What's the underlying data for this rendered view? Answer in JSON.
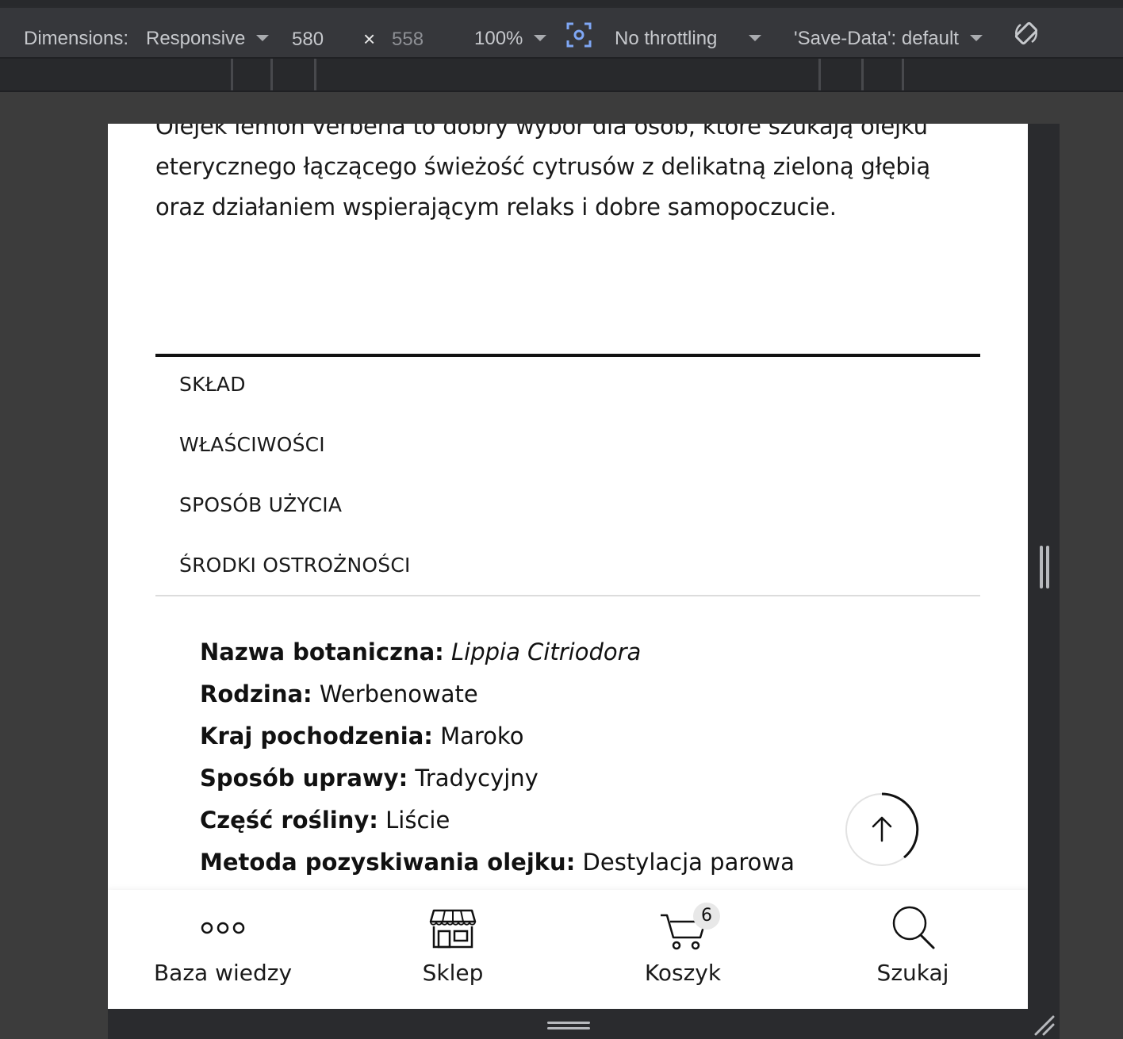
{
  "devtools": {
    "dimensions_label": "Dimensions:",
    "mode": "Responsive",
    "width": "580",
    "times": "×",
    "height": "558",
    "zoom": "100%",
    "throttling": "No throttling",
    "save_data": "'Save-Data': default"
  },
  "page": {
    "intro_lines": [
      "Olejek lemon verbena to dobry wybór dla osób, które szukają olejku",
      "eterycznego łączącego świeżość cytrusów z delikatną zieloną głębią",
      "oraz działaniem wspierającym relaks i dobre samopoczucie."
    ],
    "tabs": [
      {
        "label": "SKŁAD"
      },
      {
        "label": "WŁAŚCIWOŚCI"
      },
      {
        "label": "SPOSÓB UŻYCIA"
      },
      {
        "label": "ŚRODKI OSTROŻNOŚCI"
      }
    ],
    "specs": [
      {
        "key": "Nazwa botaniczna:",
        "value": "Lippia Citriodora"
      },
      {
        "key": "Rodzina:",
        "value": "Werbenowate"
      },
      {
        "key": "Kraj pochodzenia:",
        "value": "Maroko"
      },
      {
        "key": "Sposób uprawy:",
        "value": "Tradycyjny"
      },
      {
        "key": "Część rośliny:",
        "value": "Liście"
      },
      {
        "key": "Metoda pozyskiwania olejku:",
        "value": "Destylacja parowa"
      }
    ],
    "back_to_top_icon": "arrow-up-icon"
  },
  "bottom_nav": {
    "items": [
      {
        "label": "Baza wiedzy",
        "icon": "dots-icon"
      },
      {
        "label": "Sklep",
        "icon": "shop-icon"
      },
      {
        "label": "Koszyk",
        "icon": "cart-icon",
        "badge": "6"
      },
      {
        "label": "Szukaj",
        "icon": "search-icon"
      }
    ]
  }
}
